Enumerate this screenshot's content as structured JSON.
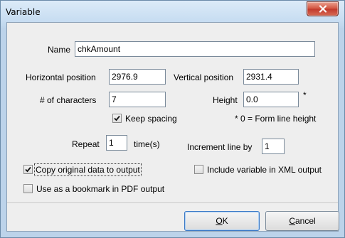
{
  "window": {
    "title": "Variable"
  },
  "form": {
    "name_label": "Name",
    "name_value": "chkAmount",
    "hpos_label": "Horizontal position",
    "hpos_value": "2976.9",
    "vpos_label": "Vertical position",
    "vpos_value": "2931.4",
    "chars_label": "# of characters",
    "chars_value": "7",
    "height_label": "Height",
    "height_value": "0.0",
    "height_asterisk": "*",
    "keep_spacing_label": "Keep spacing",
    "keep_spacing_checked": true,
    "height_note": "* 0 = Form line height",
    "repeat_label": "Repeat",
    "repeat_value": "1",
    "repeat_unit": "time(s)",
    "increment_label": "Increment line by",
    "increment_value": "1",
    "copy_original_label": "Copy original data to output",
    "copy_original_checked": true,
    "include_xml_label": "Include variable in XML output",
    "include_xml_checked": false,
    "bookmark_label": "Use as a bookmark in PDF output",
    "bookmark_checked": false
  },
  "buttons": {
    "ok_label": "OK",
    "ok_mnemonic": "O",
    "ok_rest": "K",
    "cancel_label": "Cancel",
    "cancel_mnemonic": "C",
    "cancel_rest": "ancel"
  }
}
